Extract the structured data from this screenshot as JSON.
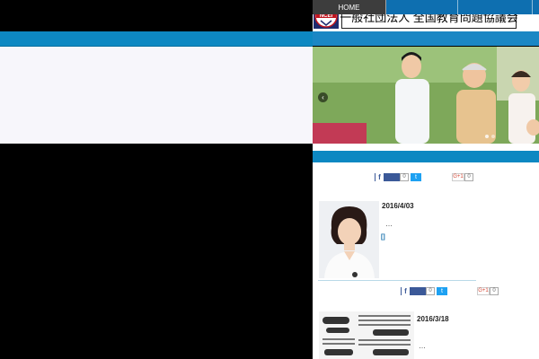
{
  "header": {
    "logo_text": "NCEI",
    "site_title": "一般社団法人 全国教育問題協議会"
  },
  "nav": {
    "items": [
      {
        "label": "HOME"
      },
      {
        "label": ""
      },
      {
        "label": ""
      },
      {
        "label": ""
      }
    ]
  },
  "slider": {
    "prev_icon": "chevron-left-icon",
    "prev_glyph": "‹"
  },
  "share": {
    "facebook_glyph": "f",
    "twitter_glyph": "t",
    "gplus_label": "G+1"
  },
  "posts": [
    {
      "date": "2016/4/03",
      "excerpt": "…",
      "link_marker": "[]",
      "fb_count": "0",
      "gplus_count": "0"
    },
    {
      "date": "2016/3/18",
      "excerpt": "…",
      "fb_count": "0",
      "gplus_count": "0"
    }
  ],
  "colors": {
    "accent_blue": "#0d88c2",
    "nav_home_bg": "#3d3d3d",
    "left_panel_bg": "#f7f6fb"
  }
}
